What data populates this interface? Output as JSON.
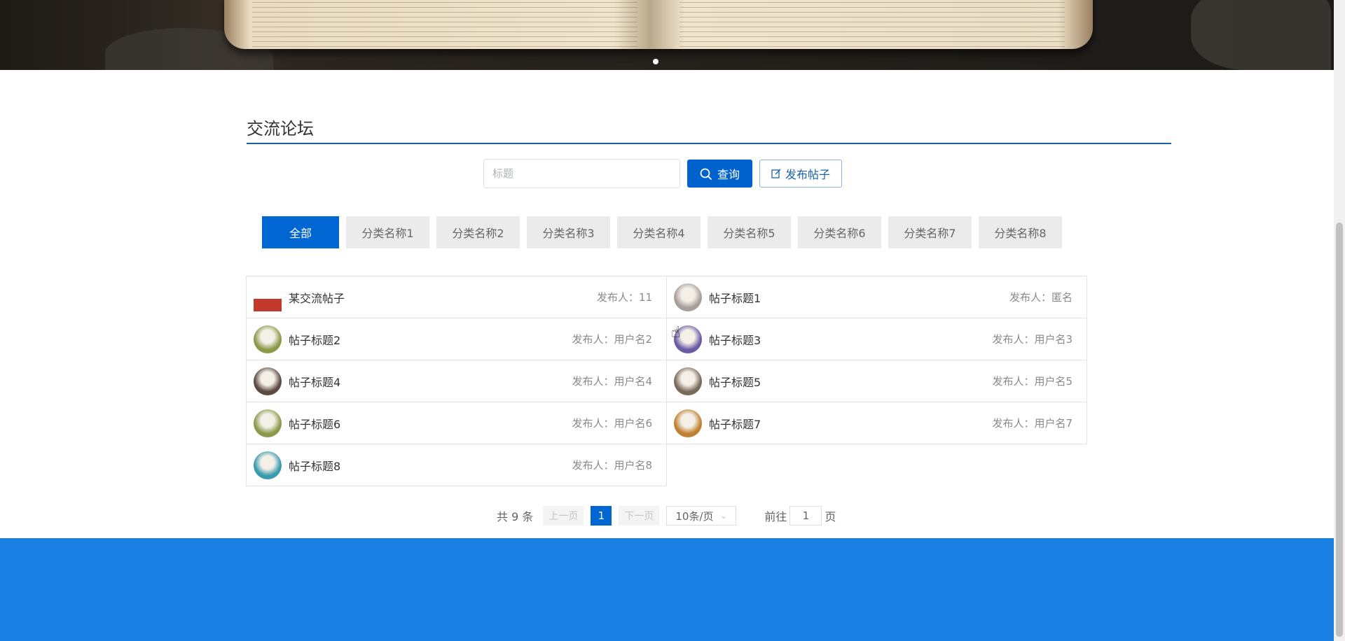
{
  "banner": {
    "carousel_dots": 1
  },
  "section": {
    "title": "交流论坛"
  },
  "search": {
    "placeholder": "标题",
    "value": ""
  },
  "buttons": {
    "query_label": "查询",
    "post_label": "发布帖子"
  },
  "tabs": [
    {
      "label": "全部",
      "active": true
    },
    {
      "label": "分类名称1"
    },
    {
      "label": "分类名称2"
    },
    {
      "label": "分类名称3"
    },
    {
      "label": "分类名称4"
    },
    {
      "label": "分类名称5"
    },
    {
      "label": "分类名称6"
    },
    {
      "label": "分类名称7"
    },
    {
      "label": "分类名称8"
    }
  ],
  "posts": [
    {
      "title": "某交流帖子",
      "author": "发布人：11",
      "avatar_color": "#c23a2b"
    },
    {
      "title": "帖子标题1",
      "author": "发布人：匿名",
      "avatar_color": "#a89f9c"
    },
    {
      "title": "帖子标题2",
      "author": "发布人：用户名2",
      "avatar_color": "#8a9a4a"
    },
    {
      "title": "帖子标题3",
      "author": "发布人：用户名3",
      "avatar_color": "#6b5aa8"
    },
    {
      "title": "帖子标题4",
      "author": "发布人：用户名4",
      "avatar_color": "#5a4a40"
    },
    {
      "title": "帖子标题5",
      "author": "发布人：用户名5",
      "avatar_color": "#7a6a5a"
    },
    {
      "title": "帖子标题6",
      "author": "发布人：用户名6",
      "avatar_color": "#8a9a4a"
    },
    {
      "title": "帖子标题7",
      "author": "发布人：用户名7",
      "avatar_color": "#c08030"
    },
    {
      "title": "帖子标题8",
      "author": "发布人：用户名8",
      "avatar_color": "#3a9ab0"
    }
  ],
  "pagination": {
    "total": "共 9 条",
    "prev": "上一页",
    "current": "1",
    "next": "下一页",
    "page_size": "10条/页",
    "goto_prefix": "前往",
    "goto_value": "1",
    "goto_suffix": "页"
  },
  "colors": {
    "primary": "#0066d2",
    "footer": "#1b80e4",
    "title_underline": "#1a62a8"
  }
}
